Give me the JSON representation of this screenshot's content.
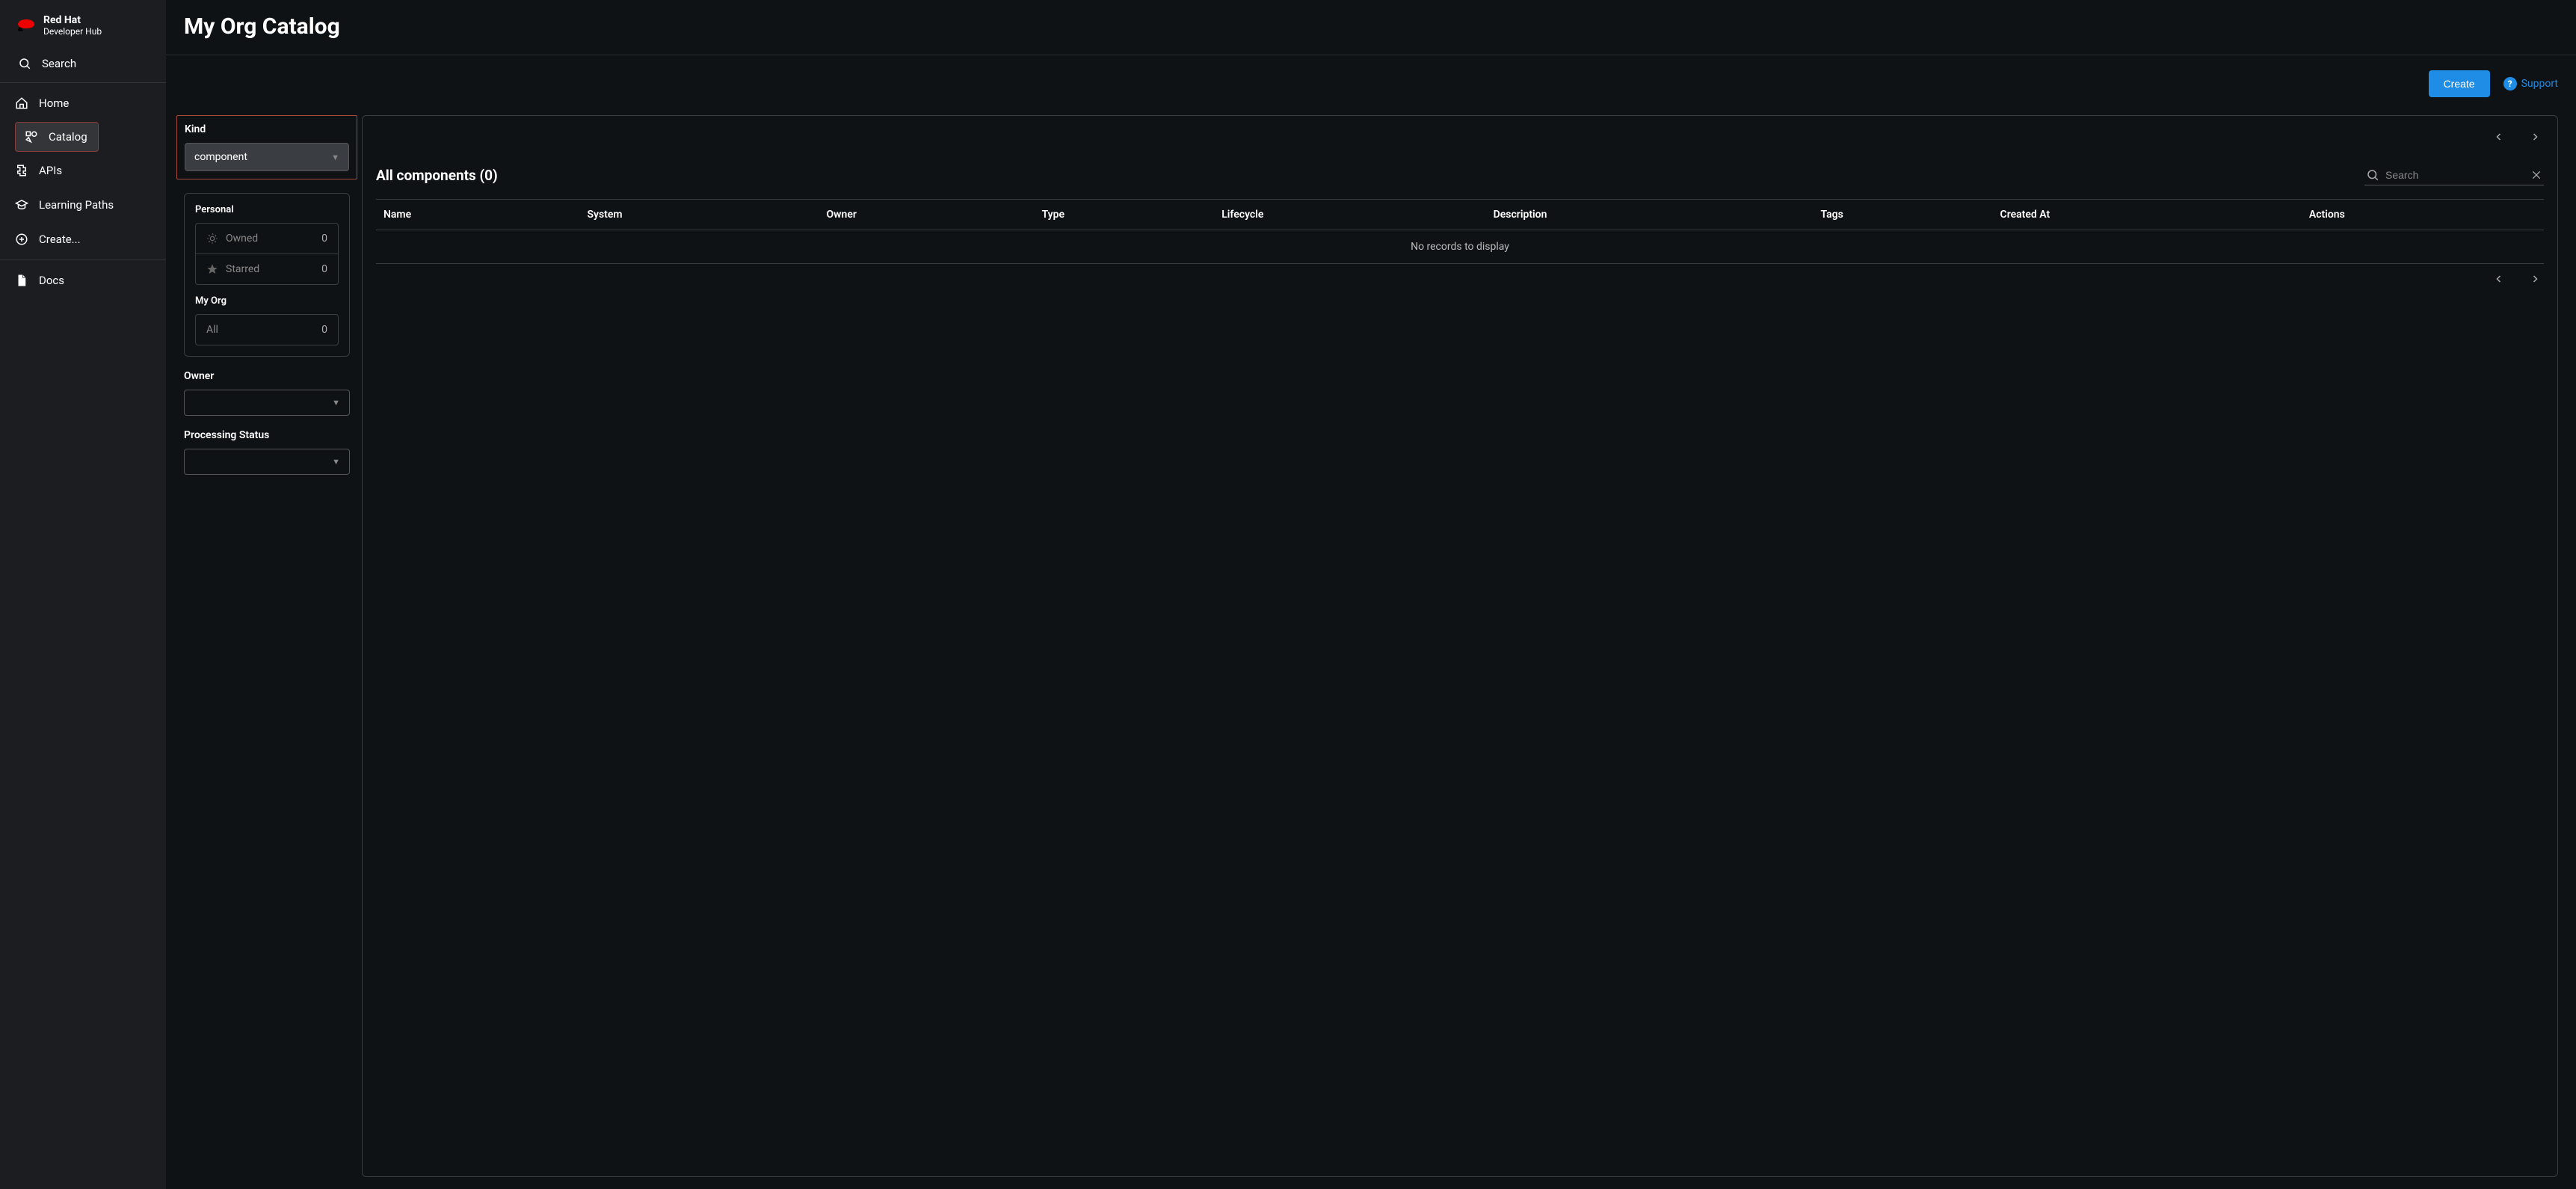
{
  "brand": {
    "line1": "Red Hat",
    "line2": "Developer Hub"
  },
  "sidebar": {
    "search_label": "Search",
    "items": [
      {
        "label": "Home"
      },
      {
        "label": "Catalog"
      },
      {
        "label": "APIs"
      },
      {
        "label": "Learning Paths"
      },
      {
        "label": "Create..."
      }
    ],
    "docs_label": "Docs"
  },
  "page": {
    "title": "My Org Catalog"
  },
  "actions": {
    "create_label": "Create",
    "support_label": "Support"
  },
  "filters": {
    "kind_label": "Kind",
    "kind_value": "component",
    "personal_label": "Personal",
    "owned_label": "Owned",
    "owned_count": "0",
    "starred_label": "Starred",
    "starred_count": "0",
    "org_label": "My Org",
    "all_label": "All",
    "all_count": "0",
    "owner_label": "Owner",
    "processing_label": "Processing Status"
  },
  "results": {
    "title": "All components (0)",
    "search_placeholder": "Search",
    "empty_message": "No records to display",
    "columns": [
      "Name",
      "System",
      "Owner",
      "Type",
      "Lifecycle",
      "Description",
      "Tags",
      "Created At",
      "Actions"
    ]
  }
}
